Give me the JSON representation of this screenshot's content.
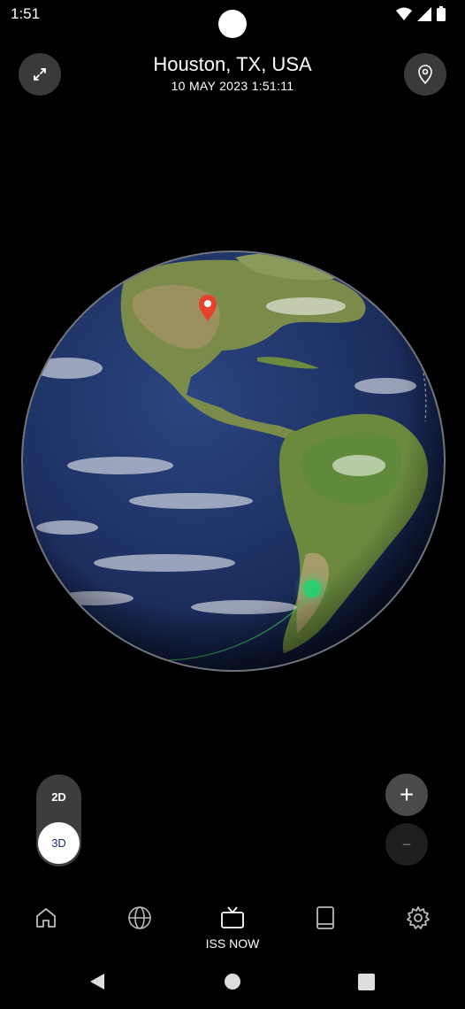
{
  "status": {
    "time": "1:51"
  },
  "header": {
    "location": "Houston, TX, USA",
    "datetime": "10 MAY 2023 1:51:11"
  },
  "view_mode": {
    "options": [
      "2D",
      "3D"
    ],
    "selected": "3D"
  },
  "zoom": {
    "in_label": "+",
    "out_label": "−"
  },
  "bottom_nav": {
    "items": [
      {
        "icon": "home-icon"
      },
      {
        "icon": "globe-icon"
      },
      {
        "icon": "tv-icon",
        "label": "ISS NOW",
        "active": true
      },
      {
        "icon": "book-icon"
      },
      {
        "icon": "gear-icon"
      }
    ]
  },
  "colors": {
    "marker": "#e8412c",
    "iss": "#2ecc71",
    "ocean": "#1b2e5e",
    "land": "#6b8a3e"
  }
}
